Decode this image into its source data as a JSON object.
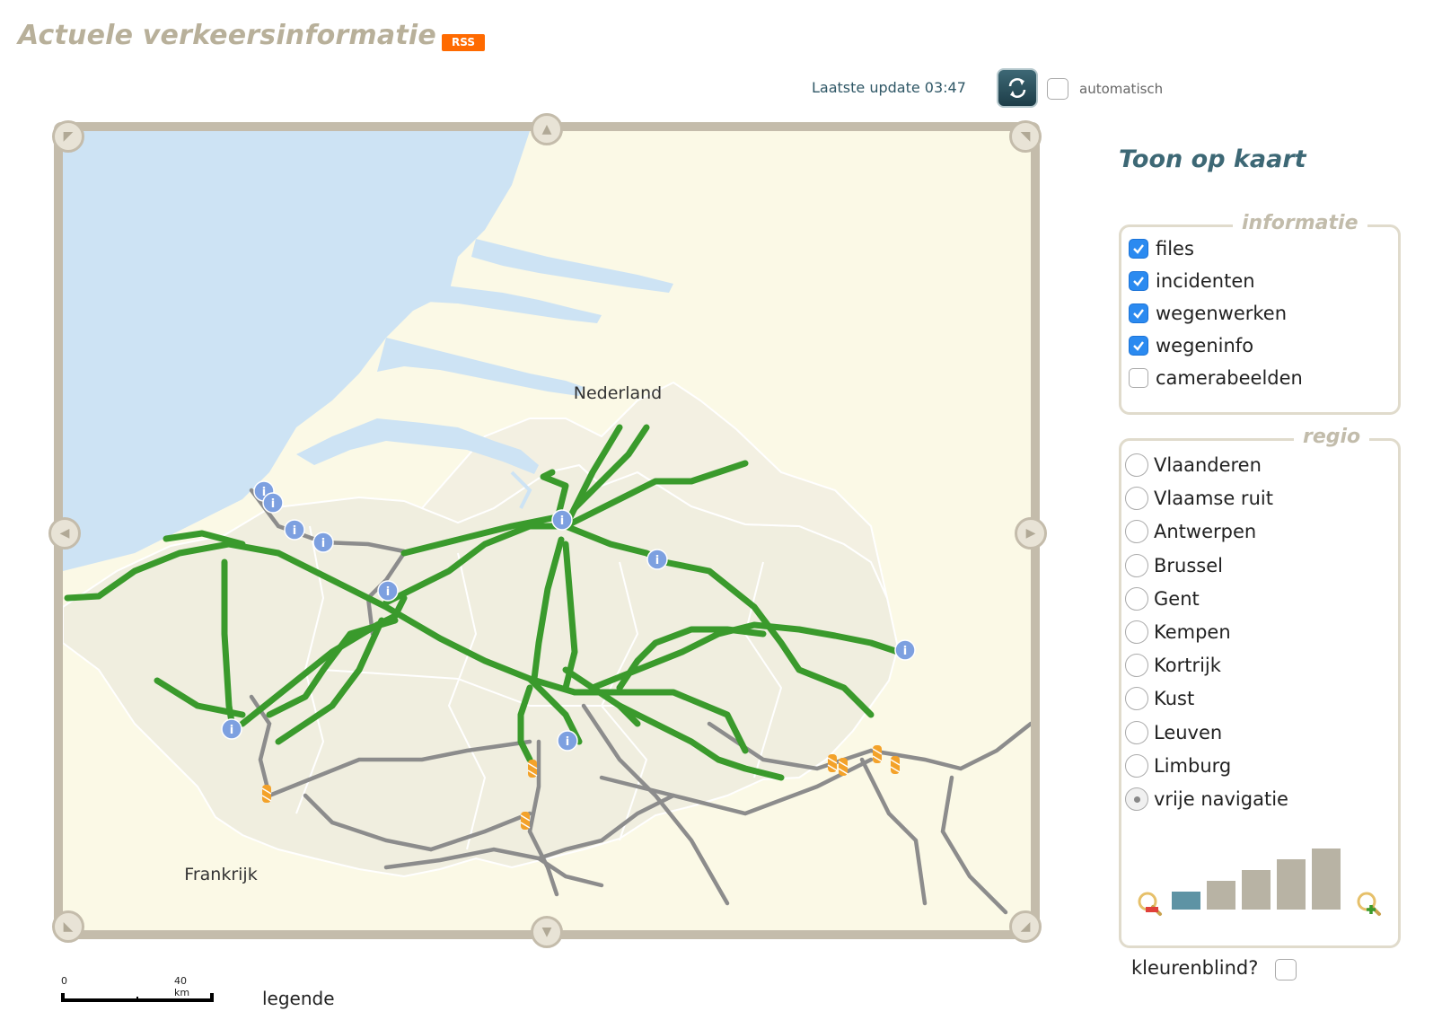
{
  "header": {
    "title": "Actuele verkeersinformatie",
    "rss_label": "RSS",
    "update_label": "Laatste update 03:47",
    "auto_label": "automatisch",
    "auto_checked": false
  },
  "map": {
    "label_nl": "Nederland",
    "label_fr": "Frankrijk",
    "scale_start": "0",
    "scale_end": "40 km",
    "legend_link": "legende",
    "colors": {
      "sea": "#cde3f4",
      "land_be": "#f0eedf",
      "land_other": "#fbf9e6",
      "highway_free": "#3a9a2c",
      "highway_other": "#8c8c8c",
      "info_marker": "#7da0e0",
      "roadworks_marker": "#f3a22a"
    }
  },
  "panel": {
    "title": "Toon op kaart",
    "info_legend": "informatie",
    "info_options": [
      {
        "label": "files",
        "checked": true
      },
      {
        "label": "incidenten",
        "checked": true
      },
      {
        "label": "wegenwerken",
        "checked": true
      },
      {
        "label": "wegeninfo",
        "checked": true
      },
      {
        "label": "camerabeelden",
        "checked": false
      }
    ],
    "regio_legend": "regio",
    "regio_options": [
      {
        "label": "Vlaanderen",
        "selected": false
      },
      {
        "label": "Vlaamse ruit",
        "selected": false
      },
      {
        "label": "Antwerpen",
        "selected": false
      },
      {
        "label": "Brussel",
        "selected": false
      },
      {
        "label": "Gent",
        "selected": false
      },
      {
        "label": "Kempen",
        "selected": false
      },
      {
        "label": "Kortrijk",
        "selected": false
      },
      {
        "label": "Kust",
        "selected": false
      },
      {
        "label": "Leuven",
        "selected": false
      },
      {
        "label": "Limburg",
        "selected": false
      },
      {
        "label": "vrije navigatie",
        "selected": true
      }
    ],
    "zoom_level": 1,
    "zoom_levels": 5,
    "colorblind_label": "kleurenblind?",
    "colorblind_checked": false
  }
}
